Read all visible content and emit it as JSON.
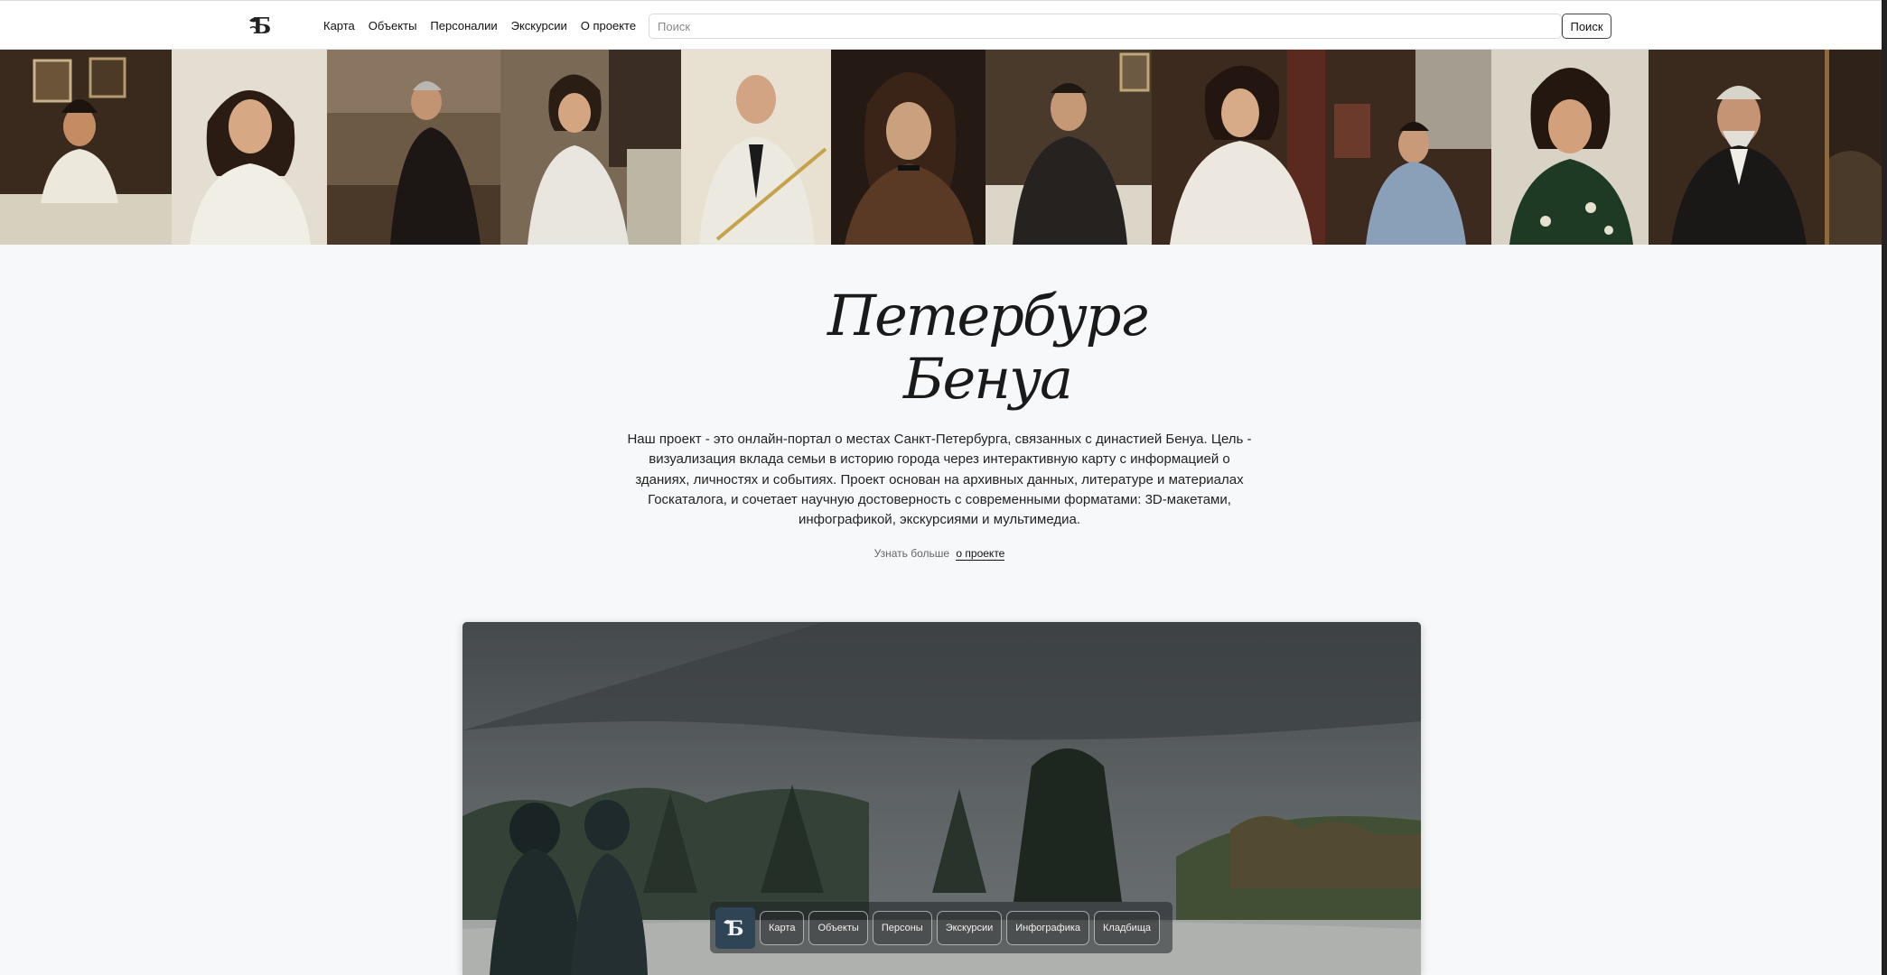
{
  "header": {
    "nav": [
      "Карта",
      "Объекты",
      "Персоналии",
      "Экскурсии",
      "О проекте"
    ],
    "search_placeholder": "Поиск",
    "search_button": "Поиск"
  },
  "hero_title": {
    "line1": "Петербург",
    "line2": "Бенуа"
  },
  "intro": {
    "text": "Наш проект - это онлайн-портал о местах Санкт-Петербурга, связанных с династией Бенуа. Цель - визуализация вклада семьи в историю города через интерактивную карту с информацией о зданиях, личностях и событиях. Проект основан на архивных данных, литературе и материалах Госкаталога, и сочетает научную достоверность с современными форматами: 3D-макетами, инфографикой, экскурсиями и мультимедиа.",
    "more_prefix": "Узнать больше",
    "more_link": "о проекте"
  },
  "dock": {
    "buttons": [
      "Карта",
      "Объекты",
      "Персоны",
      "Экскурсии",
      "Инфографика",
      "Кладбища"
    ]
  },
  "colors": {
    "accent": "#2f4556",
    "background": "#f7f8fa"
  }
}
